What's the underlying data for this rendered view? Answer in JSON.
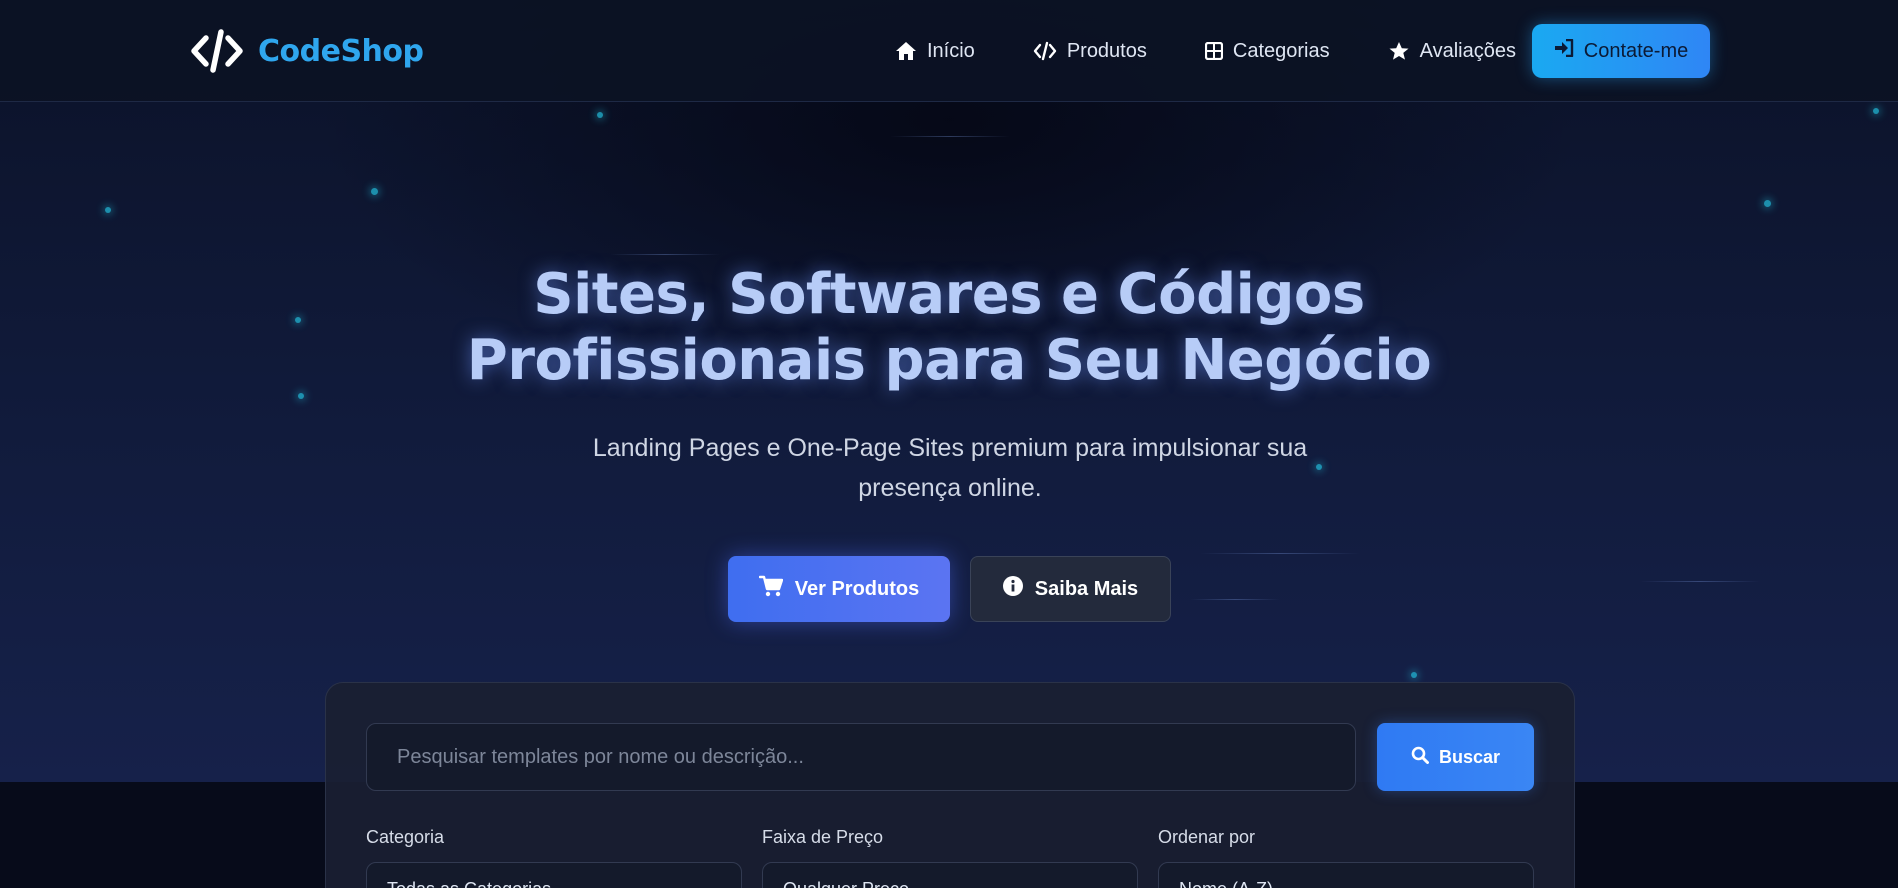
{
  "brand": {
    "name": "CodeShop",
    "icon": "code-brackets-icon",
    "color": "#2fa6ee"
  },
  "nav": {
    "items": [
      {
        "label": "Início",
        "icon": "home-icon"
      },
      {
        "label": "Produtos",
        "icon": "code-icon"
      },
      {
        "label": "Categorias",
        "icon": "grid-icon"
      },
      {
        "label": "Avaliações",
        "icon": "star-icon"
      }
    ],
    "cta": {
      "label": "Contate-me",
      "icon": "sign-in-icon"
    }
  },
  "hero": {
    "title_line1": "Sites, Softwares e Códigos",
    "title_line2": "Profissionais para Seu Negócio",
    "subtitle": "Landing Pages e One-Page Sites premium para impulsionar sua presença online.",
    "primary_button": {
      "label": "Ver Produtos",
      "icon": "cart-icon"
    },
    "secondary_button": {
      "label": "Saiba Mais",
      "icon": "info-icon"
    }
  },
  "search": {
    "placeholder": "Pesquisar templates por nome ou descrição...",
    "button_label": "Buscar",
    "button_icon": "search-icon"
  },
  "filters": [
    {
      "label": "Categoria",
      "value": "Todas as Categorias"
    },
    {
      "label": "Faixa de Preço",
      "value": "Qualquer Preço"
    },
    {
      "label": "Ordenar por",
      "value": "Nome (A-Z)"
    }
  ],
  "colors": {
    "accent": "#2f86f5",
    "cta_start": "#1aa9f1",
    "primary_button": "#4a70f1",
    "background": "#0a0f1f"
  }
}
